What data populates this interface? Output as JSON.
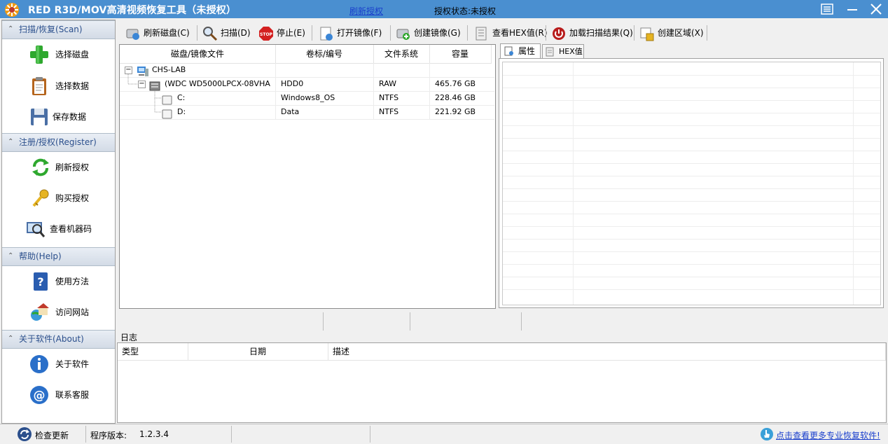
{
  "window": {
    "title": "RED R3D/MOV高清视频恢复工具（未授权）"
  },
  "sidebar": {
    "sections": [
      {
        "header": "扫描/恢复(Scan)",
        "items": [
          "选择磁盘",
          "选择数据",
          "保存数据"
        ]
      },
      {
        "header": "注册/授权(Register)",
        "items": [
          "刷新授权",
          "购买授权",
          "查看机器码"
        ]
      },
      {
        "header": "帮助(Help)",
        "items": [
          "使用方法",
          "访问网站"
        ]
      },
      {
        "header": "关于软件(About)",
        "items": [
          "关于软件",
          "联系客服"
        ]
      }
    ]
  },
  "toolbar": {
    "refresh_disk": "刷新磁盘(C)",
    "scan": "扫描(D)",
    "stop": "停止(E)",
    "open_image": "打开镜像(F)",
    "create_image": "创建镜像(G)",
    "view_hex": "查看HEX值(R)",
    "load_results": "加载扫描结果(Q)",
    "create_region": "创建区域(X)"
  },
  "disk_table": {
    "columns": [
      "磁盘/镜像文件",
      "卷标/编号",
      "文件系统",
      "容量"
    ],
    "rows": [
      {
        "name": "CHS-LAB",
        "label": "",
        "fs": "",
        "size": ""
      },
      {
        "name": "(WDC WD5000LPCX-08VHA",
        "label": "HDD0",
        "fs": "RAW",
        "size": "465.76 GB"
      },
      {
        "name": "C:",
        "label": "Windows8_OS",
        "fs": "NTFS",
        "size": "228.46 GB"
      },
      {
        "name": "D:",
        "label": "Data",
        "fs": "NTFS",
        "size": "221.92 GB"
      }
    ]
  },
  "right_tabs": {
    "properties": "属性",
    "hex": "HEX值"
  },
  "auth": {
    "refresh_link": "刷新授权",
    "status": "授权状态:未授权"
  },
  "log": {
    "title": "日志",
    "columns": [
      "类型",
      "日期",
      "描述"
    ]
  },
  "statusbar": {
    "check_update": "检查更新",
    "version_label": "程序版本:",
    "version": "1.2.3.4",
    "more_link": "点击查看更多专业恢复软件!"
  },
  "colors": {
    "titlebar": "#4a8fd0",
    "section_header_text": "#2b4f8c",
    "link": "#1a3fcc"
  }
}
